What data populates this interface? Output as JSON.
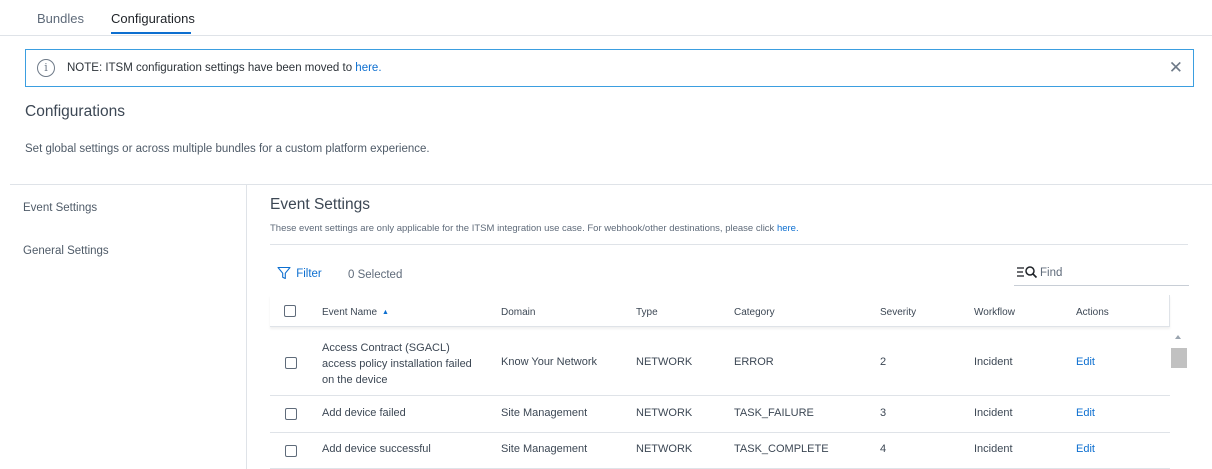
{
  "tabs": [
    {
      "label": "Bundles",
      "active": false
    },
    {
      "label": "Configurations",
      "active": true
    }
  ],
  "notice": {
    "text": "NOTE: ITSM configuration settings have been moved to",
    "link_text": "here.",
    "info_icon": "i",
    "close_icon": "✕"
  },
  "page": {
    "title": "Configurations",
    "description": "Set global settings or across multiple bundles for a custom platform experience."
  },
  "sidebar": {
    "items": [
      {
        "label": "Event Settings"
      },
      {
        "label": "General Settings"
      }
    ]
  },
  "section": {
    "title": "Event Settings",
    "description": "These event settings are only applicable for the ITSM integration use case. For webhook/other destinations, please click",
    "link_text": "here."
  },
  "toolbar": {
    "filter_label": "Filter",
    "selected_label": "0 Selected",
    "find_placeholder": "Find",
    "find_icon": "☰🔍"
  },
  "table": {
    "columns": {
      "event_name": "Event Name",
      "domain": "Domain",
      "type": "Type",
      "category": "Category",
      "severity": "Severity",
      "workflow": "Workflow",
      "actions": "Actions"
    },
    "sort_indicator": "▲",
    "rows": [
      {
        "event_name": "Access Contract (SGACL) access policy installation failed on the device",
        "domain": "Know Your Network",
        "type": "NETWORK",
        "category": "ERROR",
        "severity": "2",
        "workflow": "Incident",
        "action": "Edit"
      },
      {
        "event_name": "Add device failed",
        "domain": "Site Management",
        "type": "NETWORK",
        "category": "TASK_FAILURE",
        "severity": "3",
        "workflow": "Incident",
        "action": "Edit"
      },
      {
        "event_name": "Add device successful",
        "domain": "Site Management",
        "type": "NETWORK",
        "category": "TASK_COMPLETE",
        "severity": "4",
        "workflow": "Incident",
        "action": "Edit"
      }
    ]
  },
  "colors": {
    "accent": "#0d6fd0",
    "notice_border": "#3b9ee0",
    "divider": "#dfe3e8"
  }
}
